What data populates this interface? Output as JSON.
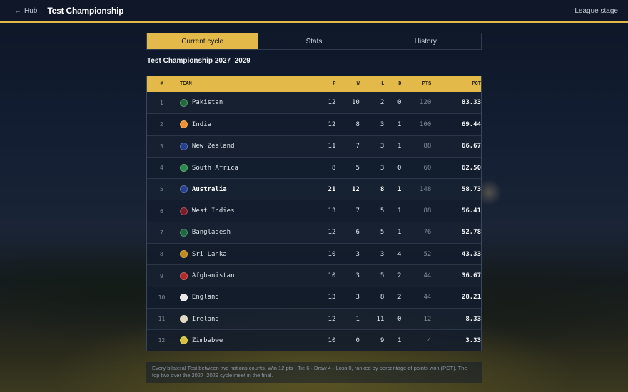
{
  "header": {
    "back_label": "Hub",
    "title": "Test Championship",
    "stage": "League stage"
  },
  "tabs": [
    {
      "label": "Current cycle",
      "active": true
    },
    {
      "label": "Stats",
      "active": false
    },
    {
      "label": "History",
      "active": false
    }
  ],
  "subtitle": "Test Championship 2027–2029",
  "table": {
    "columns": {
      "rank": "#",
      "team": "TEAM",
      "p": "P",
      "w": "W",
      "l": "L",
      "d": "D",
      "pts": "PTS",
      "pct": "PCT"
    },
    "rows": [
      {
        "rank": "1",
        "team": "Pakistan",
        "p": "12",
        "w": "10",
        "l": "2",
        "d": "0",
        "pts": "120",
        "pct": "83.33",
        "flag_color": "#1f6b3a",
        "flag_icon": "pakistan-flag-icon"
      },
      {
        "rank": "2",
        "team": "India",
        "p": "12",
        "w": "8",
        "l": "3",
        "d": "1",
        "pts": "100",
        "pct": "69.44",
        "flag_color": "#f0902e",
        "flag_icon": "india-flag-icon"
      },
      {
        "rank": "3",
        "team": "New Zealand",
        "p": "11",
        "w": "7",
        "l": "3",
        "d": "1",
        "pts": "88",
        "pct": "66.67",
        "flag_color": "#253f8f",
        "flag_icon": "new-zealand-flag-icon"
      },
      {
        "rank": "4",
        "team": "South Africa",
        "p": "8",
        "w": "5",
        "l": "3",
        "d": "0",
        "pts": "60",
        "pct": "62.50",
        "flag_color": "#2a8a4a",
        "flag_icon": "south-africa-flag-icon"
      },
      {
        "rank": "5",
        "team": "Australia",
        "p": "21",
        "w": "12",
        "l": "8",
        "d": "1",
        "pts": "148",
        "pct": "58.73",
        "flag_color": "#27408f",
        "flag_icon": "australia-flag-icon",
        "highlight": true
      },
      {
        "rank": "6",
        "team": "West Indies",
        "p": "13",
        "w": "7",
        "l": "5",
        "d": "1",
        "pts": "88",
        "pct": "56.41",
        "flag_color": "#7a1c2a",
        "flag_icon": "west-indies-flag-icon"
      },
      {
        "rank": "7",
        "team": "Bangladesh",
        "p": "12",
        "w": "6",
        "l": "5",
        "d": "1",
        "pts": "76",
        "pct": "52.78",
        "flag_color": "#1b6a3e",
        "flag_icon": "bangladesh-flag-icon"
      },
      {
        "rank": "8",
        "team": "Sri Lanka",
        "p": "10",
        "w": "3",
        "l": "3",
        "d": "4",
        "pts": "52",
        "pct": "43.33",
        "flag_color": "#c28a1c",
        "flag_icon": "sri-lanka-flag-icon"
      },
      {
        "rank": "9",
        "team": "Afghanistan",
        "p": "10",
        "w": "3",
        "l": "5",
        "d": "2",
        "pts": "44",
        "pct": "36.67",
        "flag_color": "#b22a2a",
        "flag_icon": "afghanistan-flag-icon"
      },
      {
        "rank": "10",
        "team": "England",
        "p": "13",
        "w": "3",
        "l": "8",
        "d": "2",
        "pts": "44",
        "pct": "28.21",
        "flag_color": "#e8e8e8",
        "flag_icon": "england-flag-icon"
      },
      {
        "rank": "11",
        "team": "Ireland",
        "p": "12",
        "w": "1",
        "l": "11",
        "d": "0",
        "pts": "12",
        "pct": "8.33",
        "flag_color": "#e0d8c0",
        "flag_icon": "ireland-flag-icon"
      },
      {
        "rank": "12",
        "team": "Zimbabwe",
        "p": "10",
        "w": "0",
        "l": "9",
        "d": "1",
        "pts": "4",
        "pct": "3.33",
        "flag_color": "#d8c23a",
        "flag_icon": "zimbabwe-flag-icon"
      }
    ]
  },
  "footnote": "Every bilateral Test between two nations counts. Win 12 pts · Tie 6 · Draw 4 · Loss 0, ranked by percentage of points won (PCT). The top two over the 2027–2029 cycle meet in the final.",
  "colors": {
    "accent": "#e3b94a",
    "header_bg": "#0f1728",
    "table_bg": "#121c2c"
  }
}
